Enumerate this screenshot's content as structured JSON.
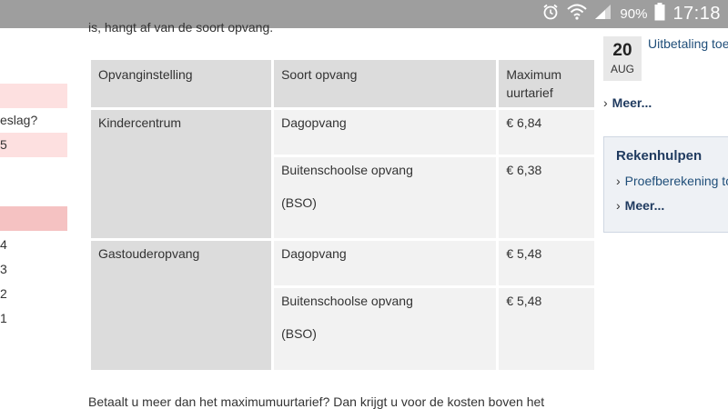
{
  "statusbar": {
    "battery_pct": "90%",
    "time": "17:18"
  },
  "intro_text": "is, hangt af van de soort opvang.",
  "table": {
    "headers": [
      "Opvanginstelling",
      "Soort opvang",
      "Maximum uurtarief"
    ],
    "groups": [
      {
        "institution": "Kindercentrum",
        "rows": [
          {
            "type": "Dagopvang",
            "type2": "",
            "rate": "€ 6,84"
          },
          {
            "type": "Buitenschoolse opvang",
            "type2": "(BSO)",
            "rate": "€ 6,38"
          }
        ]
      },
      {
        "institution": "Gastouderopvang",
        "rows": [
          {
            "type": "Dagopvang",
            "type2": "",
            "rate": "€ 5,48"
          },
          {
            "type": "Buitenschoolse opvang",
            "type2": "(BSO)",
            "rate": "€ 5,48"
          }
        ]
      }
    ]
  },
  "footer_text": "Betaalt u meer dan het maximumuurtarief? Dan krijgt u voor de kosten boven het",
  "left_sidebar": {
    "question": "eslag?",
    "value": "5",
    "numbers": [
      "4",
      "3",
      "2",
      "1"
    ],
    "colors": {
      "light": "#fde0e0",
      "strong": "#f5c2c2"
    }
  },
  "right_sidebar": {
    "date_day": "20",
    "date_month": "AUG",
    "news_link": "Uitbetaling toe",
    "more_label_1": "Meer...",
    "panel_title": "Rekenhulpen",
    "panel_item": "Proefberekening to",
    "more_label_2": "Meer..."
  }
}
